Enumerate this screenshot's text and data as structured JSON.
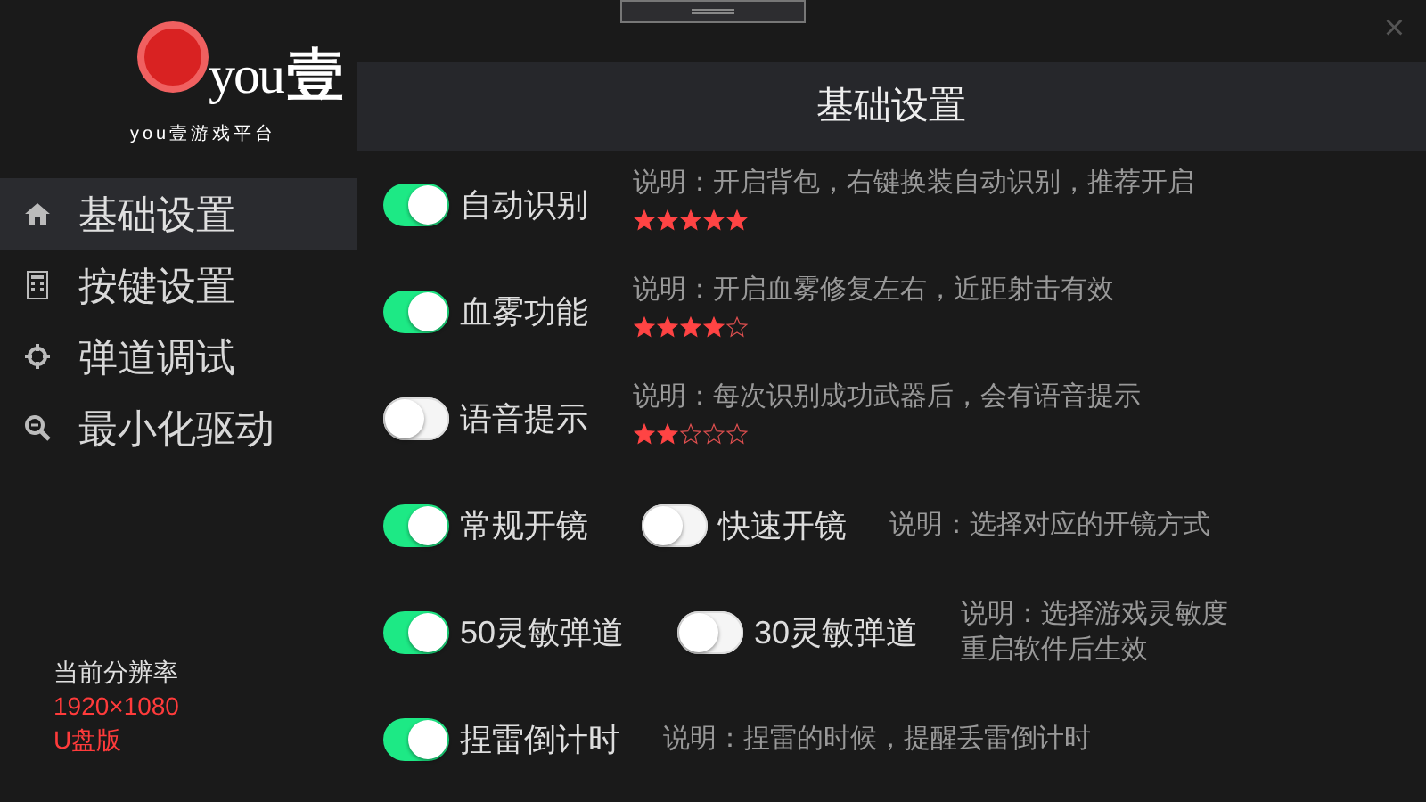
{
  "logo": {
    "brand": "you",
    "brand_char": "壹",
    "subtitle": "you壹游戏平台"
  },
  "close": "×",
  "sidebar": {
    "items": [
      {
        "label": "基础设置",
        "selected": true
      },
      {
        "label": "按键设置",
        "selected": false
      },
      {
        "label": "弹道调试",
        "selected": false
      },
      {
        "label": "最小化驱动",
        "selected": false
      }
    ]
  },
  "info": {
    "label": "当前分辨率",
    "resolution": "1920×1080",
    "edition": "U盘版"
  },
  "header": {
    "title": "基础设置"
  },
  "rows": [
    {
      "toggles": [
        {
          "label": "自动识别",
          "on": true
        }
      ],
      "description": [
        "说明：开启背包，右键换装自动识别，推荐开启"
      ],
      "stars": 5
    },
    {
      "toggles": [
        {
          "label": "血雾功能",
          "on": true
        }
      ],
      "description": [
        "说明：开启血雾修复左右，近距射击有效"
      ],
      "stars": 4
    },
    {
      "toggles": [
        {
          "label": "语音提示",
          "on": false
        }
      ],
      "description": [
        "说明：每次识别成功武器后，会有语音提示"
      ],
      "stars": 2
    },
    {
      "toggles": [
        {
          "label": "常规开镜",
          "on": true
        },
        {
          "label": "快速开镜",
          "on": false
        }
      ],
      "description": [
        "说明：选择对应的开镜方式"
      ]
    },
    {
      "toggles": [
        {
          "label": "50灵敏弹道",
          "on": true
        },
        {
          "label": "30灵敏弹道",
          "on": false
        }
      ],
      "description": [
        "说明：选择游戏灵敏度",
        "重启软件后生效"
      ]
    },
    {
      "toggles": [
        {
          "label": "捏雷倒计时",
          "on": true
        }
      ],
      "description": [
        "说明：捏雷的时候，提醒丢雷倒计时"
      ]
    }
  ]
}
